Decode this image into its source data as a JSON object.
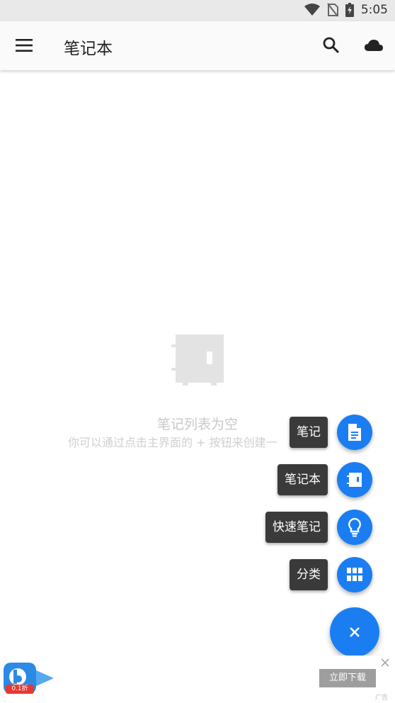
{
  "status_bar": {
    "time": "5:05",
    "icons": [
      "wifi-icon",
      "no-sim-icon",
      "battery-charging-icon"
    ]
  },
  "app_bar": {
    "title": "笔记本",
    "menu_icon": "menu-icon",
    "search_icon": "search-icon",
    "cloud_icon": "cloud-icon"
  },
  "empty_state": {
    "title": "笔记列表为空",
    "subtitle": "你可以通过点击主界面的 + 按钮来创建一",
    "icon": "notebook-icon"
  },
  "fab_menu": {
    "items": [
      {
        "label": "笔记",
        "icon": "note-icon"
      },
      {
        "label": "笔记本",
        "icon": "notebook-icon"
      },
      {
        "label": "快速笔记",
        "icon": "lightbulb-icon"
      },
      {
        "label": "分类",
        "icon": "grid-icon"
      }
    ],
    "close_icon": "close-icon"
  },
  "ad": {
    "button_label": "立即下载",
    "tag": "0.1折",
    "mark": "广告",
    "close_icon": "close-icon"
  },
  "colors": {
    "accent": "#1a7ef2",
    "label_bg": "#3a3a3a",
    "appbar_bg": "#fafafa",
    "statusbar_bg": "#e9e9e9"
  }
}
